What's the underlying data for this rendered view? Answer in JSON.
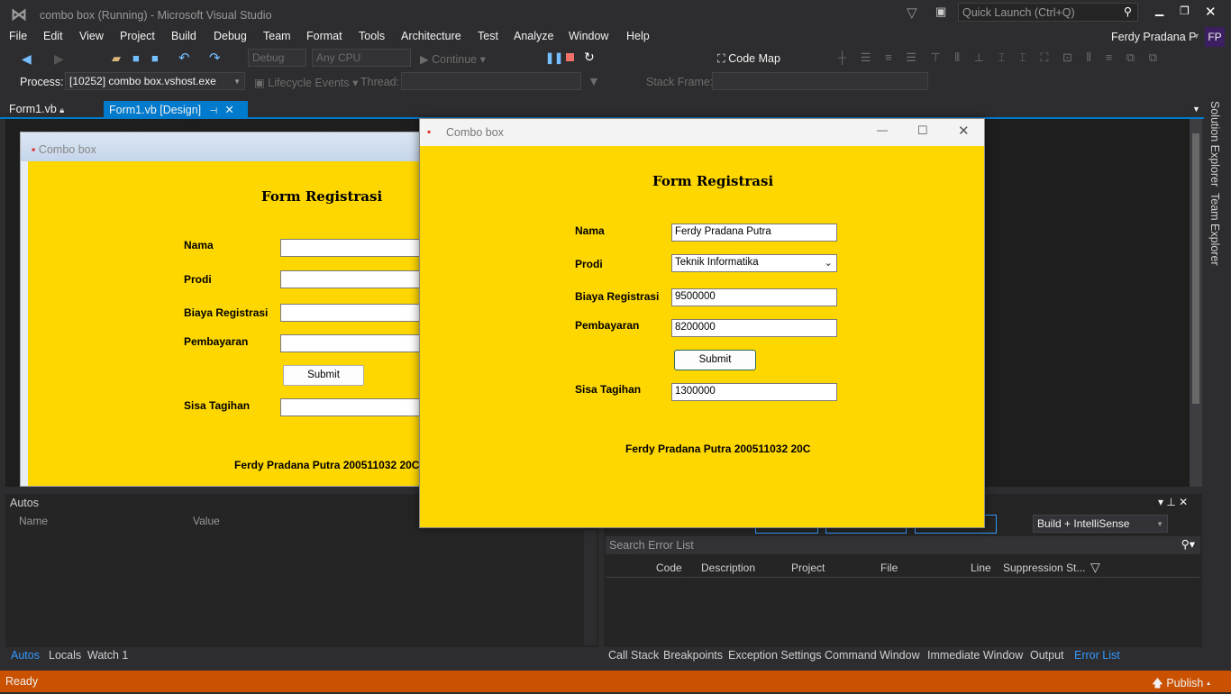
{
  "titlebar": {
    "title": "combo box (Running) - Microsoft Visual Studio",
    "quick_launch_placeholder": "Quick Launch (Ctrl+Q)"
  },
  "menu": [
    "File",
    "Edit",
    "View",
    "Project",
    "Build",
    "Debug",
    "Team",
    "Format",
    "Tools",
    "Architecture",
    "Test",
    "Analyze",
    "Window",
    "Help"
  ],
  "account": {
    "name": "Ferdy Pradana P",
    "initials": "FP"
  },
  "toolbar": {
    "config": "Debug",
    "platform": "Any CPU",
    "continue": "Continue",
    "code_map": "Code Map"
  },
  "debug_location": {
    "process_label": "Process:",
    "process": "[10252] combo box.vshost.exe",
    "lifecycle": "Lifecycle Events",
    "thread_label": "Thread:",
    "stack_label": "Stack Frame:"
  },
  "doc_tabs": [
    {
      "label": "Form1.vb"
    },
    {
      "label": "Form1.vb [Design]",
      "active": true
    }
  ],
  "side_tabs": [
    "Solution Explorer",
    "Team Explorer"
  ],
  "designer": {
    "window_title": "Combo box",
    "heading": "Form Registrasi",
    "labels": [
      "Nama",
      "Prodi",
      "Biaya Registrasi",
      "Pembayaran",
      "Sisa Tagihan"
    ],
    "submit": "Submit",
    "footer": "Ferdy Pradana Putra 200511032 20C"
  },
  "running_form": {
    "window_title": "Combo box",
    "heading": "Form Registrasi",
    "fields": [
      {
        "label": "Nama",
        "value": "Ferdy Pradana Putra"
      },
      {
        "label": "Prodi",
        "value": "Teknik Informatika"
      },
      {
        "label": "Biaya Registrasi",
        "value": "9500000"
      },
      {
        "label": "Pembayaran",
        "value": "8200000"
      },
      {
        "label": "Sisa Tagihan",
        "value": "1300000"
      }
    ],
    "submit": "Submit",
    "footer": "Ferdy Pradana Putra 200511032 20C"
  },
  "autos": {
    "title": "Autos",
    "columns": [
      "Name",
      "Value"
    ],
    "tabs": [
      "Autos",
      "Locals",
      "Watch 1"
    ]
  },
  "error_list": {
    "scope": "Build + IntelliSense",
    "search_placeholder": "Search Error List",
    "columns": [
      "Code",
      "Description",
      "Project",
      "File",
      "Line",
      "Suppression St..."
    ],
    "tabs": [
      "Call Stack",
      "Breakpoints",
      "Exception Settings",
      "Command Window",
      "Immediate Window",
      "Output",
      "Error List"
    ]
  },
  "status": {
    "text": "Ready",
    "publish": "Publish"
  },
  "colors": {
    "accent": "#007acc",
    "status": "#ca5100",
    "form_bg": "#ffd700"
  }
}
